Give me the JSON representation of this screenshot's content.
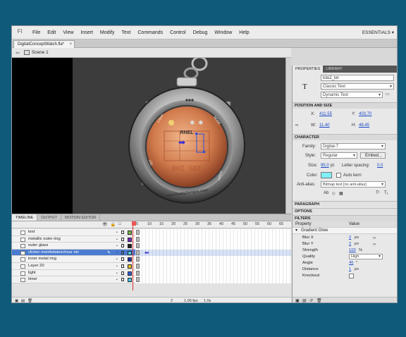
{
  "app": {
    "menu": [
      "File",
      "Edit",
      "View",
      "Insert",
      "Modify",
      "Text",
      "Commands",
      "Control",
      "Debug",
      "Window",
      "Help"
    ],
    "workspace": "ESSENTIALS",
    "doc_tab": "DigitalConceptWatch.fla*",
    "scene": "Scene 1"
  },
  "watch": {
    "brand": "RNEL",
    "url": "www.GeddyDesigns.com",
    "side_labels": [
      "LIGHT",
      "MODE",
      "SET",
      "START"
    ],
    "footer_label": "BHI GBI"
  },
  "timeline": {
    "tabs": [
      "TIMELINE",
      "OUTPUT",
      "MOTION EDITOR"
    ],
    "frame_numbers": [
      "5",
      "10",
      "15",
      "20",
      "25",
      "30",
      "35",
      "40",
      "45",
      "50",
      "55",
      "60",
      "65"
    ],
    "layers": [
      {
        "name": "text",
        "color": "#7ab648"
      },
      {
        "name": "metallic outer ring",
        "color": "#7a28c8"
      },
      {
        "name": "outer glass",
        "color": "#222222"
      },
      {
        "name": "clicker monthdateschour etc",
        "color": "#4cc8e8"
      },
      {
        "name": "inner metal ring",
        "color": "#2030b0"
      },
      {
        "name": "Layer 20",
        "color": "#e8c020"
      },
      {
        "name": "light",
        "color": "#3060d8"
      },
      {
        "name": "timer",
        "color": "#4cc8e8"
      }
    ],
    "selected_index": 3,
    "footer": {
      "frame": "2",
      "fps": "1.00 fps",
      "time": "1.0s"
    }
  },
  "properties": {
    "tabs": [
      "PROPERTIES",
      "LIBRARY"
    ],
    "instance_name": "lcto2_txt",
    "text_engine": "Classic Text",
    "text_type": "Dynamic Text",
    "position_section": "POSITION AND SIZE",
    "x_label": "X:",
    "x": "411.55",
    "y_label": "Y:",
    "y": "403.70",
    "w_label": "W:",
    "w": "11.40",
    "h_label": "H:",
    "h": "48.45",
    "character_section": "CHARACTER",
    "family_label": "Family:",
    "family": "Digital-7",
    "style_label": "Style:",
    "style": "Regular",
    "embed": "Embed...",
    "size_label": "Size:",
    "size": "95.0",
    "size_unit": "pt",
    "letter_spacing_label": "Letter spacing:",
    "letter_spacing": "0.0",
    "color_label": "Color:",
    "color": "#80f0f8",
    "auto_kern": "Auto kern",
    "anti_alias_label": "Anti-alias:",
    "anti_alias": "Bitmap text [no anti-alias]",
    "paragraph_section": "PARAGRAPH",
    "options_section": "OPTIONS",
    "filters_section": "FILTERS",
    "filters_cols": [
      "Property",
      "Value"
    ],
    "filter_name": "Gradient Glow",
    "filter_rows": [
      {
        "k": "Blur X",
        "v": "2",
        "u": "px"
      },
      {
        "k": "Blur Y",
        "v": "2",
        "u": "px"
      },
      {
        "k": "Strength",
        "v": "100",
        "u": "%"
      },
      {
        "k": "Quality",
        "v": "High",
        "u": ""
      },
      {
        "k": "Angle",
        "v": "45",
        "u": "°"
      },
      {
        "k": "Distance",
        "v": "1",
        "u": "px"
      },
      {
        "k": "Knockout",
        "v": "",
        "u": ""
      }
    ]
  }
}
